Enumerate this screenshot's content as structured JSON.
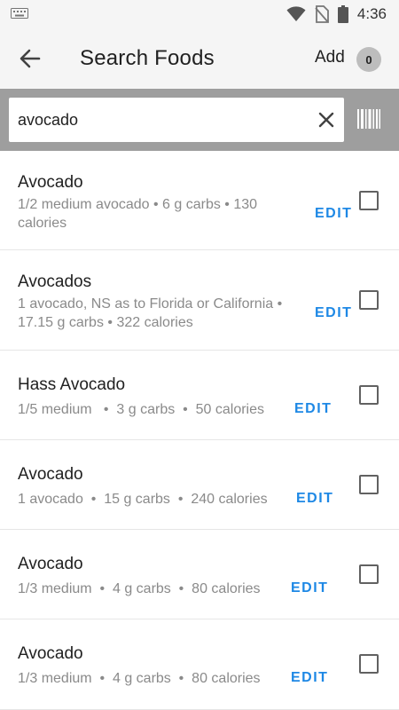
{
  "status_bar": {
    "time": "4:36",
    "icons": [
      "keyboard-icon",
      "wifi-icon",
      "no-sim-icon",
      "battery-icon"
    ]
  },
  "app_bar": {
    "title": "Search Foods",
    "add_label": "Add",
    "count": "0"
  },
  "search": {
    "value": "avocado"
  },
  "results": [
    {
      "name": "Avocado",
      "desc": "1/2 medium avocado  •  6 g carbs  •  130 calories",
      "edit": "EDIT"
    },
    {
      "name": "Avocados",
      "desc": "1 avocado, NS as to Florida or California  •  17.15 g carbs  •  322 calories",
      "edit": "EDIT"
    },
    {
      "name": "Hass Avocado",
      "desc": "1/5 medium   •  3 g carbs  •  50 calories",
      "edit": "EDIT"
    },
    {
      "name": "Avocado",
      "desc": "1 avocado  •  15 g carbs  •  240 calories",
      "edit": "EDIT"
    },
    {
      "name": "Avocado",
      "desc": "1/3 medium  •  4 g carbs  •  80 calories",
      "edit": "EDIT"
    },
    {
      "name": "Avocado",
      "desc": "1/3 medium  •  4 g carbs  •  80 calories",
      "edit": "EDIT"
    }
  ],
  "colors": {
    "accent": "#1e88e5",
    "search_band": "#9e9e9e",
    "badge": "#bdbdbd"
  }
}
